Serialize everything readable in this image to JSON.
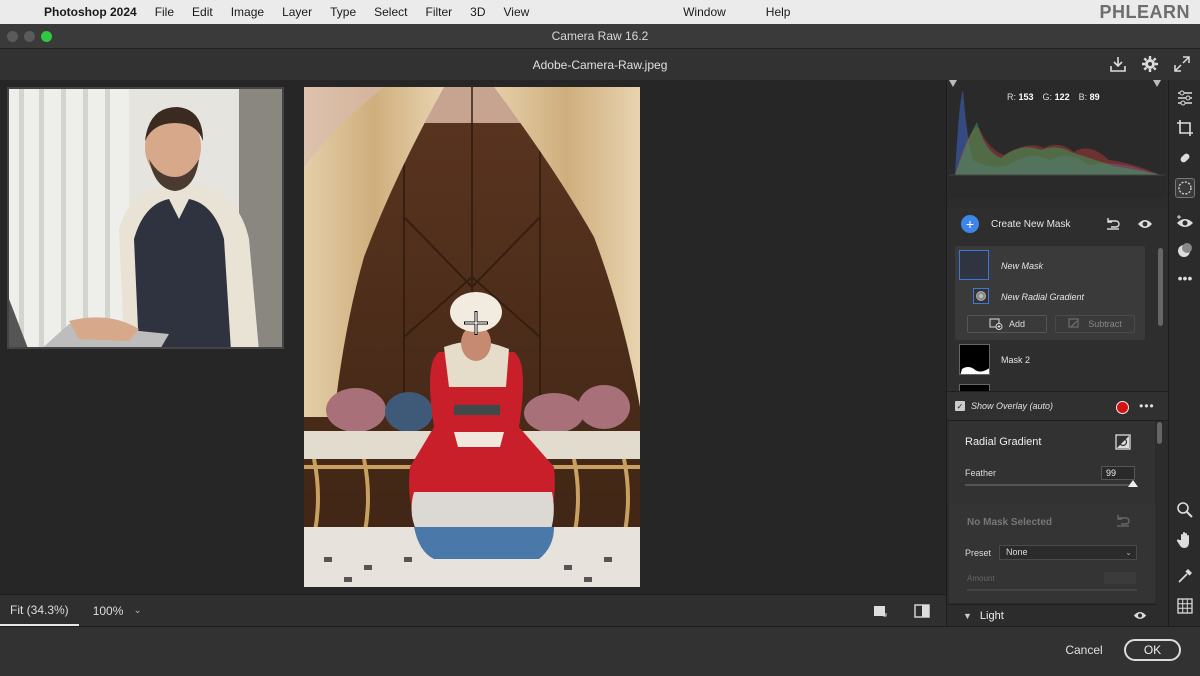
{
  "menubar": {
    "app": "Photoshop 2024",
    "items": [
      "File",
      "Edit",
      "Image",
      "Layer",
      "Type",
      "Select",
      "Filter",
      "3D",
      "View"
    ],
    "right_items": [
      "Window",
      "Help"
    ],
    "brand": "PHLEARN"
  },
  "window": {
    "title": "Camera Raw 16.2"
  },
  "document": {
    "filename": "Adobe-Camera-Raw.jpeg"
  },
  "histogram": {
    "r_label": "R:",
    "r": "153",
    "g_label": "G:",
    "g": "122",
    "b_label": "B:",
    "b": "89"
  },
  "masks": {
    "create_label": "Create New Mask",
    "new_mask": "New Mask",
    "new_radial": "New Radial Gradient",
    "add": "Add",
    "subtract": "Subtract",
    "mask2": "Mask 2",
    "show_overlay": "Show Overlay (auto)",
    "overlay_color": "#d51212"
  },
  "radial": {
    "title": "Radial Gradient",
    "feather_label": "Feather",
    "feather_value": "99",
    "feather_fraction": 0.99
  },
  "nomask": {
    "title": "No Mask Selected",
    "preset_label": "Preset",
    "preset_value": "None",
    "amount_label": "Amount"
  },
  "section": {
    "light": "Light"
  },
  "zoom": {
    "fit": "Fit (34.3%)",
    "level": "100%"
  },
  "footer": {
    "cancel": "Cancel",
    "ok": "OK"
  },
  "colors": {
    "accent": "#3d86e8",
    "panel": "#2c2c2c",
    "canvas": "#262626"
  }
}
